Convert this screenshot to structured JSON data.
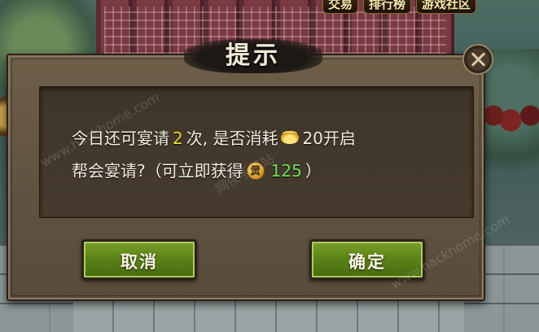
{
  "top_menu": {
    "items": [
      {
        "label": "交易"
      },
      {
        "label": "排行榜"
      },
      {
        "label": "游戏社区"
      }
    ]
  },
  "dialog": {
    "title": "提示",
    "message": {
      "line1_prefix": "今日还可宴请",
      "remaining_count": "2",
      "line1_mid": "次, 是否消耗",
      "cost_value": "20开启",
      "line2_prefix": "帮会宴请?（可立即获得",
      "reward_value": "125",
      "line2_suffix": "）"
    },
    "cancel_label": "取消",
    "confirm_label": "确定"
  },
  "watermarks": [
    "www.hackhome.com",
    "网侠手机站",
    "www.hackhome.com"
  ],
  "colors": {
    "highlight_yellow": "#f3d63a",
    "highlight_green": "#6fe05a",
    "button_green": "#5c8418"
  }
}
